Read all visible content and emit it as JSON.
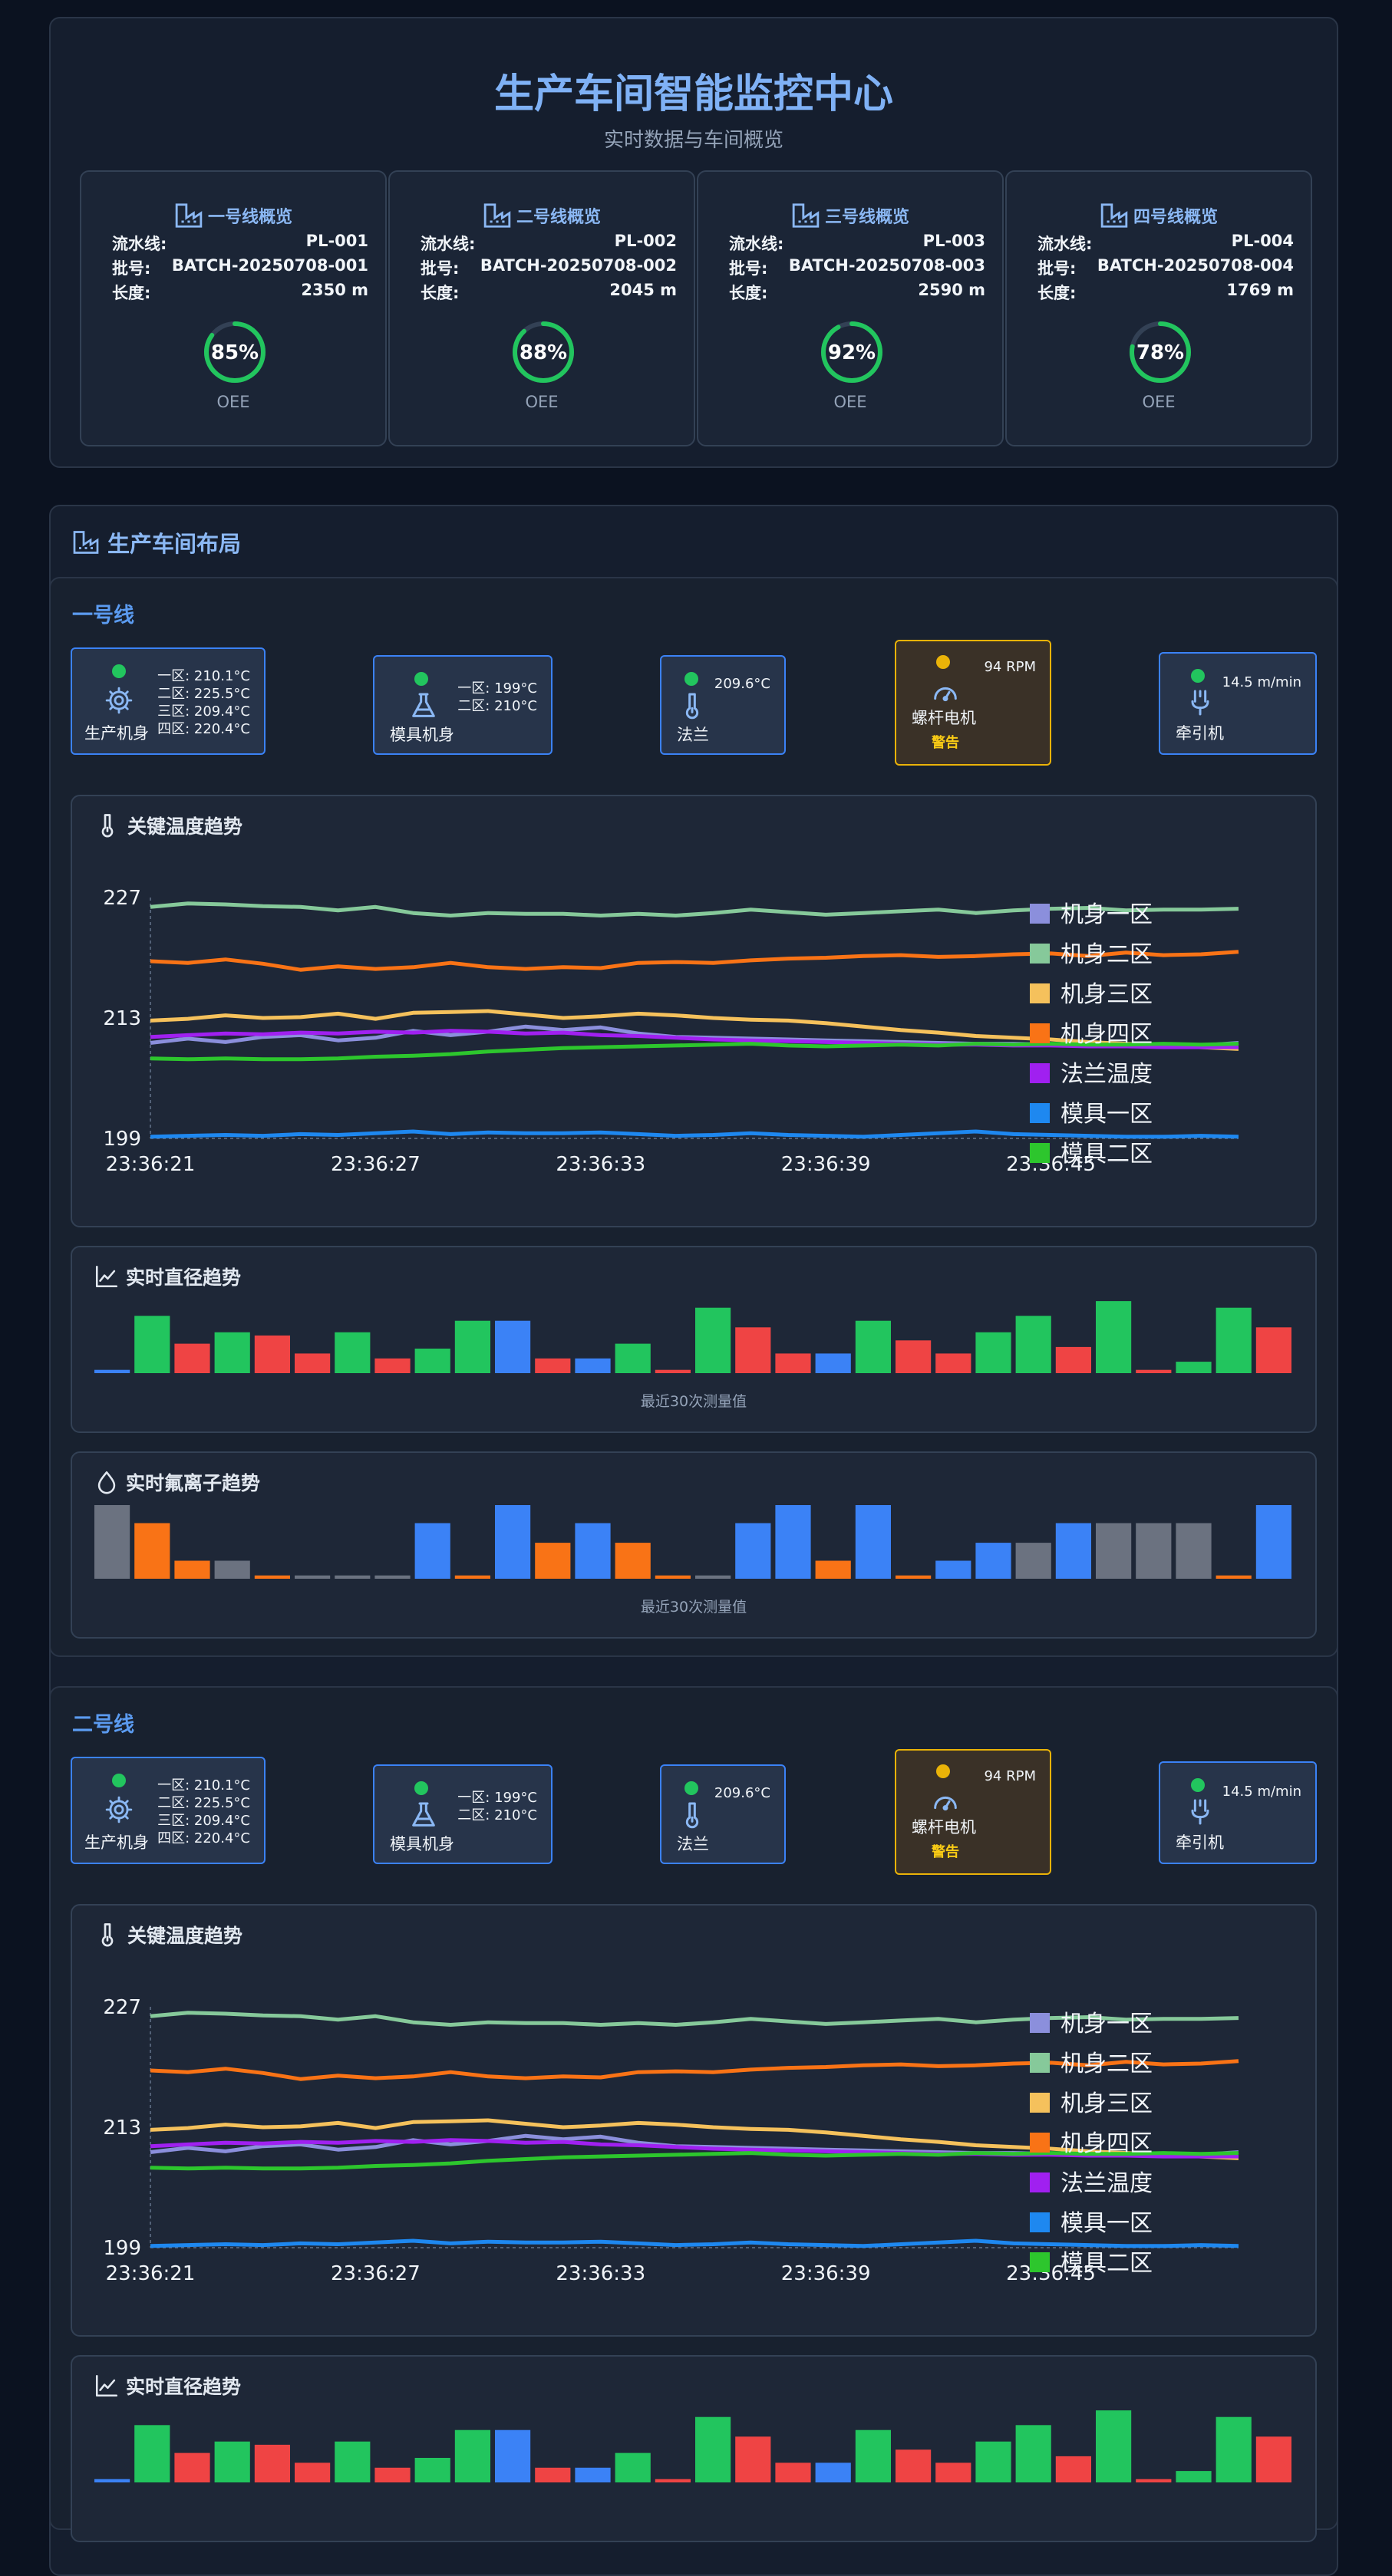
{
  "header": {
    "title": "生产车间智能监控中心",
    "subtitle": "实时数据与车间概览"
  },
  "overview_cards": [
    {
      "title": "一号线概览",
      "line_label": "流水线:",
      "line_id": "PL-001",
      "batch_label": "批号:",
      "batch": "BATCH-20250708-001",
      "length_label": "长度:",
      "length": "2350 m",
      "oee": "85%",
      "oee_value": 85,
      "oee_label": "OEE"
    },
    {
      "title": "二号线概览",
      "line_label": "流水线:",
      "line_id": "PL-002",
      "batch_label": "批号:",
      "batch": "BATCH-20250708-002",
      "length_label": "长度:",
      "length": "2045 m",
      "oee": "88%",
      "oee_value": 88,
      "oee_label": "OEE"
    },
    {
      "title": "三号线概览",
      "line_label": "流水线:",
      "line_id": "PL-003",
      "batch_label": "批号:",
      "batch": "BATCH-20250708-003",
      "length_label": "长度:",
      "length": "2590 m",
      "oee": "92%",
      "oee_value": 92,
      "oee_label": "OEE"
    },
    {
      "title": "四号线概览",
      "line_label": "流水线:",
      "line_id": "PL-004",
      "batch_label": "批号:",
      "batch": "BATCH-20250708-004",
      "length_label": "长度:",
      "length": "1769 m",
      "oee": "78%",
      "oee_value": 78,
      "oee_label": "OEE"
    }
  ],
  "layout_section": {
    "title": "生产车间布局"
  },
  "lines": [
    {
      "title": "一号线",
      "equipment": {
        "body": {
          "name": "生产机身",
          "r1": "一区: 210.1°C",
          "r2": "二区: 225.5°C",
          "r3": "三区: 209.4°C",
          "r4": "四区: 220.4°C"
        },
        "mold": {
          "name": "模具机身",
          "r1": "一区: 199°C",
          "r2": "二区: 210°C"
        },
        "flange": {
          "name": "法兰",
          "r1": "209.6°C"
        },
        "motor": {
          "name": "螺杆电机",
          "r1": "94 RPM",
          "warn": "警告"
        },
        "puller": {
          "name": "牵引机",
          "r1": "14.5 m/min"
        }
      },
      "temp_title": "关键温度趋势",
      "diam_title": "实时直径趋势",
      "diam_note": "最近30次测量值",
      "fluor_title": "实时氟离子趋势",
      "fluor_note": "最近30次测量值"
    },
    {
      "title": "二号线",
      "equipment": {
        "body": {
          "name": "生产机身",
          "r1": "一区: 210.1°C",
          "r2": "二区: 225.5°C",
          "r3": "三区: 209.4°C",
          "r4": "四区: 220.4°C"
        },
        "mold": {
          "name": "模具机身",
          "r1": "一区: 199°C",
          "r2": "二区: 210°C"
        },
        "flange": {
          "name": "法兰",
          "r1": "209.6°C"
        },
        "motor": {
          "name": "螺杆电机",
          "r1": "94 RPM",
          "warn": "警告"
        },
        "puller": {
          "name": "牵引机",
          "r1": "14.5 m/min"
        }
      },
      "temp_title": "关键温度趋势",
      "diam_title": "实时直径趋势"
    }
  ],
  "chart_data": [
    {
      "type": "line",
      "x": [
        "23:36:21",
        "23:36:22",
        "23:36:23",
        "23:36:24",
        "23:36:25",
        "23:36:26",
        "23:36:27",
        "23:36:28",
        "23:36:29",
        "23:36:30",
        "23:36:31",
        "23:36:32",
        "23:36:33",
        "23:36:34",
        "23:36:35",
        "23:36:36",
        "23:36:37",
        "23:36:38",
        "23:36:39",
        "23:36:40",
        "23:36:41",
        "23:36:42",
        "23:36:43",
        "23:36:44",
        "23:36:45",
        "23:36:46",
        "23:36:47",
        "23:36:48",
        "23:36:49",
        "23:36:50"
      ],
      "x_ticks": [
        "23:36:21",
        "23:36:27",
        "23:36:33",
        "23:36:39",
        "23:36:45"
      ],
      "y_ticks": [
        "199",
        "213",
        "227"
      ],
      "ylim": [
        199,
        227
      ],
      "legend_position": "right",
      "series": [
        {
          "name": "机身一区",
          "color": "#8b8fdc",
          "values": [
            210.1,
            210.6,
            210.2,
            210.8,
            211.0,
            210.4,
            210.7,
            211.5,
            211.0,
            211.4,
            212.0,
            211.6,
            211.9,
            211.2,
            210.8,
            210.7,
            210.6,
            210.5,
            210.4,
            210.3,
            210.2,
            210.1,
            210.0,
            210.0,
            209.9,
            209.9,
            209.8,
            209.8,
            209.8,
            210.1
          ]
        },
        {
          "name": "机身二区",
          "color": "#86c99a",
          "values": [
            225.9,
            226.3,
            226.2,
            226.0,
            225.9,
            225.5,
            225.9,
            225.2,
            224.9,
            225.2,
            225.1,
            225.1,
            224.9,
            225.1,
            224.9,
            225.2,
            225.6,
            225.3,
            225.0,
            225.2,
            225.4,
            225.6,
            225.2,
            225.5,
            225.7,
            225.8,
            225.5,
            225.6,
            225.6,
            225.7
          ]
        },
        {
          "name": "机身三区",
          "color": "#f5c15c",
          "values": [
            212.7,
            212.9,
            213.3,
            213.0,
            213.1,
            213.5,
            212.9,
            213.6,
            213.7,
            213.8,
            213.4,
            213.0,
            213.2,
            213.5,
            213.3,
            213.0,
            212.8,
            212.7,
            212.4,
            212.0,
            211.6,
            211.3,
            210.9,
            210.7,
            210.5,
            210.2,
            210.0,
            209.8,
            209.6,
            209.4
          ]
        },
        {
          "name": "机身四区",
          "color": "#f97316",
          "values": [
            219.6,
            219.4,
            219.8,
            219.3,
            218.6,
            219.0,
            218.7,
            218.9,
            219.4,
            218.9,
            218.7,
            218.9,
            218.8,
            219.4,
            219.5,
            219.4,
            219.7,
            219.9,
            220.0,
            220.2,
            220.3,
            220.1,
            220.2,
            220.4,
            220.5,
            220.2,
            220.6,
            220.3,
            220.4,
            220.7
          ]
        },
        {
          "name": "法兰温度",
          "color": "#a020f0",
          "values": [
            210.8,
            211.0,
            211.2,
            211.1,
            211.3,
            211.2,
            211.4,
            211.3,
            211.5,
            211.4,
            211.2,
            211.3,
            211.0,
            210.9,
            210.7,
            210.5,
            210.4,
            210.3,
            210.2,
            210.1,
            210.0,
            209.9,
            209.9,
            209.8,
            209.8,
            209.7,
            209.7,
            209.6,
            209.6,
            209.6
          ]
        },
        {
          "name": "模具一区",
          "color": "#1e88f0",
          "values": [
            199.2,
            199.3,
            199.4,
            199.3,
            199.5,
            199.4,
            199.6,
            199.8,
            199.5,
            199.7,
            199.6,
            199.6,
            199.7,
            199.5,
            199.3,
            199.4,
            199.6,
            199.4,
            199.3,
            199.2,
            199.4,
            199.6,
            199.8,
            199.5,
            199.4,
            199.3,
            199.2,
            199.2,
            199.3,
            199.2
          ]
        },
        {
          "name": "模具二区",
          "color": "#2dc62d",
          "values": [
            208.3,
            208.2,
            208.3,
            208.2,
            208.2,
            208.3,
            208.5,
            208.6,
            208.8,
            209.1,
            209.3,
            209.5,
            209.6,
            209.7,
            209.8,
            209.9,
            210.0,
            209.8,
            209.7,
            209.8,
            209.9,
            209.8,
            210.0,
            209.9,
            210.0,
            209.9,
            209.9,
            210.0,
            209.9,
            210.0
          ]
        }
      ]
    },
    {
      "type": "bar",
      "title": "实时直径趋势",
      "series": [
        {
          "values": [
            0.02,
            0.35,
            0.18,
            0.25,
            0.23,
            0.12,
            0.25,
            0.09,
            0.15,
            0.32,
            0.32,
            0.09,
            0.09,
            0.18,
            0.02,
            0.4,
            0.28,
            0.12,
            0.12,
            0.32,
            0.2,
            0.12,
            0.25,
            0.35,
            0.16,
            0.44,
            0.02,
            0.07,
            0.4,
            0.28
          ]
        }
      ],
      "bar_colors": [
        "#3b82f6",
        "#22c55e",
        "#ef4444",
        "#22c55e",
        "#ef4444",
        "#ef4444",
        "#22c55e",
        "#ef4444",
        "#22c55e",
        "#22c55e",
        "#3b82f6",
        "#ef4444",
        "#3b82f6",
        "#22c55e",
        "#ef4444",
        "#22c55e",
        "#ef4444",
        "#ef4444",
        "#3b82f6",
        "#22c55e",
        "#ef4444",
        "#ef4444",
        "#22c55e",
        "#22c55e",
        "#ef4444",
        "#22c55e",
        "#ef4444",
        "#22c55e",
        "#22c55e",
        "#ef4444"
      ]
    },
    {
      "type": "bar",
      "title": "实时氟离子趋势",
      "series": [
        {
          "values": [
            0.45,
            0.34,
            0.11,
            0.11,
            0.02,
            0.02,
            0.02,
            0.02,
            0.34,
            0.02,
            0.45,
            0.22,
            0.34,
            0.22,
            0.02,
            0.02,
            0.34,
            0.45,
            0.11,
            0.45,
            0.02,
            0.11,
            0.22,
            0.22,
            0.34,
            0.34,
            0.34,
            0.34,
            0.02,
            0.45
          ]
        }
      ],
      "bar_colors": [
        "#6b7280",
        "#f97316",
        "#f97316",
        "#6b7280",
        "#f97316",
        "#6b7280",
        "#6b7280",
        "#6b7280",
        "#3b82f6",
        "#f97316",
        "#3b82f6",
        "#f97316",
        "#3b82f6",
        "#f97316",
        "#f97316",
        "#6b7280",
        "#3b82f6",
        "#3b82f6",
        "#f97316",
        "#3b82f6",
        "#f97316",
        "#3b82f6",
        "#3b82f6",
        "#6b7280",
        "#3b82f6",
        "#6b7280",
        "#6b7280",
        "#6b7280",
        "#f97316",
        "#3b82f6"
      ]
    }
  ]
}
